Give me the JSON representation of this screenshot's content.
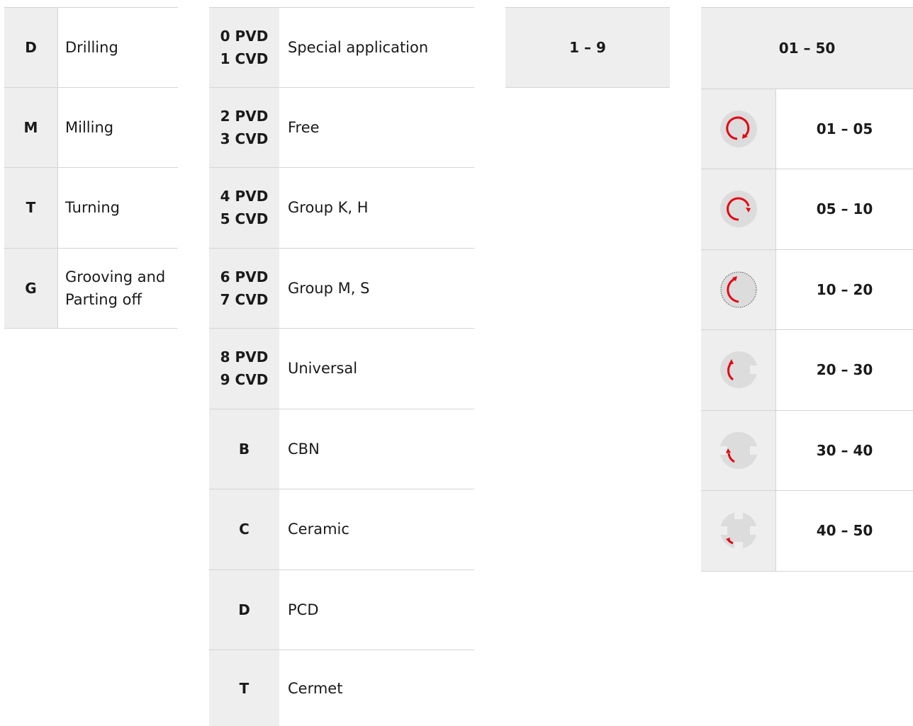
{
  "applications": [
    {
      "code": "D",
      "label": "Drilling"
    },
    {
      "code": "M",
      "label": "Milling"
    },
    {
      "code": "T",
      "label": "Turning"
    },
    {
      "code": "G",
      "label": "Grooving and Parting off"
    }
  ],
  "grades": [
    {
      "code_1": "0 PVD",
      "code_2": "1 CVD",
      "label": "Special application"
    },
    {
      "code_1": "2 PVD",
      "code_2": "3 CVD",
      "label": "Free"
    },
    {
      "code_1": "4 PVD",
      "code_2": "5 CVD",
      "label": "Group K, H"
    },
    {
      "code_1": "6 PVD",
      "code_2": "7 CVD",
      "label": "Group M, S"
    },
    {
      "code_1": "8 PVD",
      "code_2": "9 CVD",
      "label": "Universal"
    },
    {
      "code_1": "B",
      "code_2": "",
      "label": "CBN"
    },
    {
      "code_1": "C",
      "code_2": "",
      "label": "Ceramic"
    },
    {
      "code_1": "D",
      "code_2": "",
      "label": "PCD"
    },
    {
      "code_1": "T",
      "code_2": "",
      "label": "Cermet"
    }
  ],
  "range_small": {
    "header": "1 – 9"
  },
  "range_large": {
    "header": "01 – 50",
    "rows": [
      {
        "icon": "full-cut-rotation-icon",
        "range": "01 – 05"
      },
      {
        "icon": "three-quarter-cut-rotation-icon",
        "range": "05 – 10"
      },
      {
        "icon": "half-cut-rotation-icon",
        "range": "10 – 20"
      },
      {
        "icon": "interrupted-cut-icon",
        "range": "20 – 30"
      },
      {
        "icon": "heavy-interrupted-cut-icon",
        "range": "30 – 40"
      },
      {
        "icon": "severe-interrupted-cut-icon",
        "range": "40 – 50"
      }
    ]
  },
  "colors": {
    "accent": "#e30613",
    "cell_bg": "#eeeeee",
    "icon_bg": "#dcdcdc",
    "border": "#d4d4d4"
  }
}
